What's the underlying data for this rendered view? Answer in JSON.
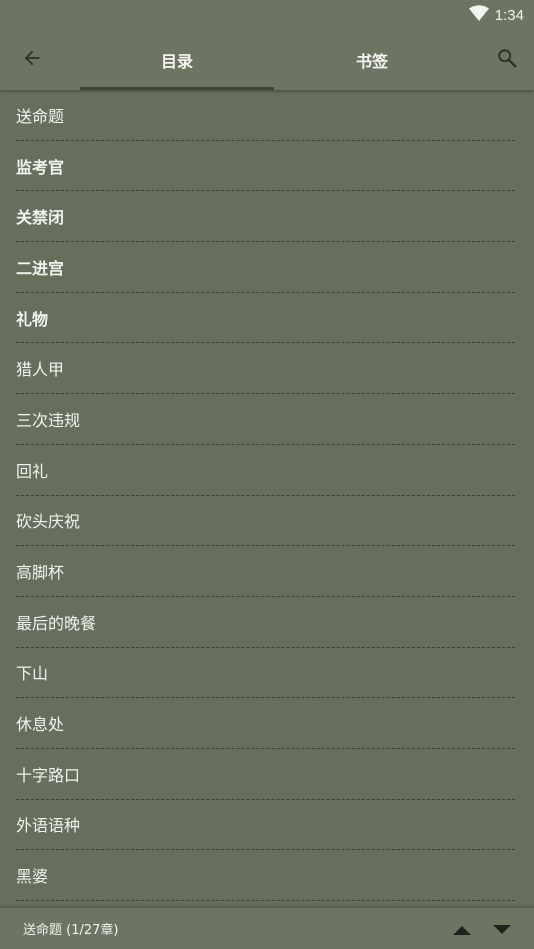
{
  "status_bar": {
    "time": "1:34",
    "icons": [
      "wifi-icon"
    ]
  },
  "app_bar": {
    "back_icon": "arrow-left-icon",
    "tabs": [
      {
        "label": "目录",
        "selected": true
      },
      {
        "label": "书签",
        "selected": false
      }
    ],
    "search_icon": "search-icon"
  },
  "chapters": [
    {
      "title": "送命题",
      "bold": false
    },
    {
      "title": "监考官",
      "bold": true
    },
    {
      "title": "关禁闭",
      "bold": true
    },
    {
      "title": "二进宫",
      "bold": true
    },
    {
      "title": "礼物",
      "bold": true
    },
    {
      "title": "猎人甲",
      "bold": false
    },
    {
      "title": "三次违规",
      "bold": false
    },
    {
      "title": "回礼",
      "bold": false
    },
    {
      "title": "砍头庆祝",
      "bold": false
    },
    {
      "title": "高脚杯",
      "bold": false
    },
    {
      "title": "最后的晚餐",
      "bold": false
    },
    {
      "title": "下山",
      "bold": false
    },
    {
      "title": "休息处",
      "bold": false
    },
    {
      "title": "十字路口",
      "bold": false
    },
    {
      "title": "外语语种",
      "bold": false
    },
    {
      "title": "黑婆",
      "bold": false
    }
  ],
  "bottom_bar": {
    "progress": "送命题 (1/27章)",
    "up_icon": "triangle-up-icon",
    "down_icon": "triangle-down-icon"
  },
  "colors": {
    "background": "#676f5c",
    "bar": "#6d7562",
    "tab_indicator": "#3f4438",
    "text": "#f1f3ee"
  }
}
